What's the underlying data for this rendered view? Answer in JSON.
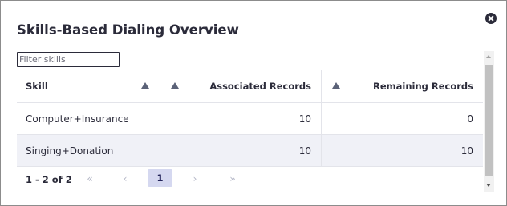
{
  "dialog": {
    "title": "Skills-Based Dialing Overview",
    "close_icon": "close-icon"
  },
  "filter": {
    "placeholder": "Filter skills",
    "value": ""
  },
  "table": {
    "columns": [
      {
        "label": "Skill",
        "sort_icon": "sort-ascending-icon"
      },
      {
        "label": "Associated Records",
        "sort_icon": "sort-ascending-icon"
      },
      {
        "label": "Remaining Records",
        "sort_icon": "sort-ascending-icon"
      }
    ],
    "rows": [
      {
        "skill": "Computer+Insurance",
        "associated": "10",
        "remaining": "0"
      },
      {
        "skill": "Singing+Donation",
        "associated": "10",
        "remaining": "10"
      }
    ]
  },
  "pager": {
    "info": "1 - 2 of 2",
    "first": "«",
    "prev": "‹",
    "current_page": "1",
    "next": "›",
    "last": "»"
  },
  "colors": {
    "text": "#2b2b3a",
    "alt_row": "#f0f1f7",
    "active_page": "#d5d8f0",
    "border": "#e3e4ea"
  }
}
